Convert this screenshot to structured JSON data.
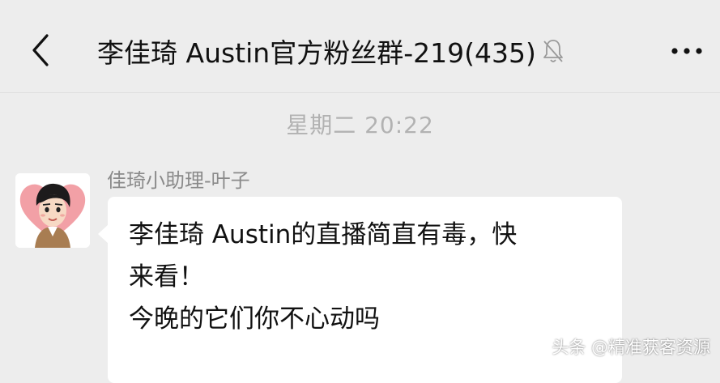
{
  "header": {
    "back_icon": "chevron-left-icon",
    "title": "李佳琦 Austin官方粉丝群-219(435)",
    "mute_icon": "bell-muted-icon",
    "more_icon": "more-dots-icon"
  },
  "chat": {
    "timestamp": "星期二 20:22",
    "messages": [
      {
        "sender": "佳琦小助理-叶子",
        "avatar_icon": "cartoon-avatar-icon",
        "lines": [
          "李佳琦 Austin的直播简直有毒，快",
          "来看！",
          "今晚的它们你不心动吗"
        ]
      }
    ]
  },
  "watermark": "头条 @精准获客资源",
  "colors": {
    "background": "#ededed",
    "bubble": "#ffffff",
    "title_text": "#111111",
    "timestamp_text": "#b2b2b2",
    "sender_text": "#8a8a8a",
    "avatar_heart": "#f2a0a6"
  }
}
